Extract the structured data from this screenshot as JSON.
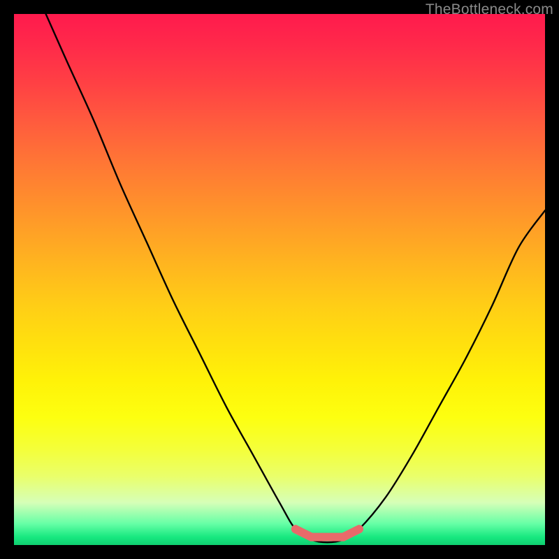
{
  "watermark": "TheBottleneck.com",
  "chart_data": {
    "type": "line",
    "title": "",
    "xlabel": "",
    "ylabel": "",
    "xlim": [
      0,
      100
    ],
    "ylim": [
      0,
      100
    ],
    "grid": false,
    "legend": false,
    "series": [
      {
        "name": "bottleneck-curve",
        "x": [
          6,
          10,
          15,
          20,
          25,
          30,
          35,
          40,
          45,
          50,
          53,
          56,
          59,
          62,
          65,
          70,
          75,
          80,
          85,
          90,
          95,
          100
        ],
        "y": [
          100,
          91,
          80,
          68,
          57,
          46,
          36,
          26,
          17,
          8,
          3,
          1,
          0.5,
          1,
          3,
          9,
          17,
          26,
          35,
          45,
          56,
          63
        ]
      }
    ],
    "flat_region": {
      "x_start": 53,
      "x_end": 65,
      "y": 1.5,
      "color": "#e86a6a"
    },
    "background_gradient": {
      "top": "#ff1a4d",
      "mid": "#ffe020",
      "bottom": "#17e880"
    }
  }
}
